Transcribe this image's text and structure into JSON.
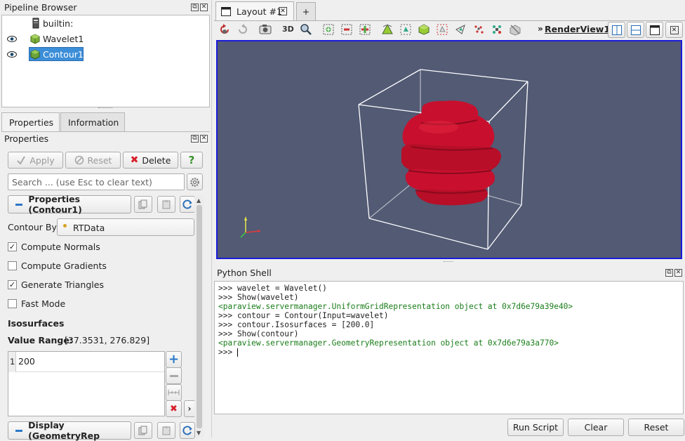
{
  "pipeline": {
    "title": "Pipeline Browser",
    "items": [
      {
        "label": "builtin:"
      },
      {
        "label": "Wavelet1"
      },
      {
        "label": "Contour1"
      }
    ]
  },
  "tabs": {
    "properties": "Properties",
    "information": "Information"
  },
  "properties": {
    "title": "Properties",
    "apply_label": "Apply",
    "reset_label": "Reset",
    "delete_label": "Delete",
    "help_label": "?",
    "search_placeholder": "Search ... (use Esc to clear text)",
    "section_label": "Properties (Contour1)",
    "contour_by_label": "Contour By",
    "contour_by_value": "RTData",
    "checkboxes": [
      {
        "label": "Compute Normals",
        "checked": true
      },
      {
        "label": "Compute Gradients",
        "checked": false
      },
      {
        "label": "Generate Triangles",
        "checked": true
      },
      {
        "label": "Fast Mode",
        "checked": false
      }
    ],
    "isosurfaces_label": "Isosurfaces",
    "value_range_label": "Value Range:",
    "value_range": "[37.3531, 276.829]",
    "iso_rows": [
      {
        "index": "1",
        "value": "200"
      }
    ],
    "display_label": "Display (GeometryRep"
  },
  "layout": {
    "tab_label": "Layout #1",
    "add_tab": "+",
    "label_3d": "3D",
    "view_label": "RenderView1"
  },
  "python_shell": {
    "title": "Python Shell",
    "lines": [
      {
        "text": ">>> wavelet = Wavelet()",
        "type": "input"
      },
      {
        "text": ">>> Show(wavelet)",
        "type": "input"
      },
      {
        "text": "<paraview.servermanager.UniformGridRepresentation object at 0x7d6e79a39e40>",
        "type": "output"
      },
      {
        "text": ">>> contour = Contour(Input=wavelet)",
        "type": "input"
      },
      {
        "text": ">>> contour.Isosurfaces = [200.0]",
        "type": "input"
      },
      {
        "text": ">>> Show(contour)",
        "type": "input"
      },
      {
        "text": "<paraview.servermanager.GeometryRepresentation object at 0x7d6e79a3a770>",
        "type": "output"
      },
      {
        "text": ">>> ",
        "type": "input"
      }
    ],
    "run_script": "Run Script",
    "clear": "Clear",
    "reset": "Reset"
  },
  "colors": {
    "accent": "#2a78c8",
    "selection": "#3c8ed8",
    "viewport_bg": "#525a74",
    "contour": "#c8102e",
    "output_text": "#1a7d1a"
  }
}
